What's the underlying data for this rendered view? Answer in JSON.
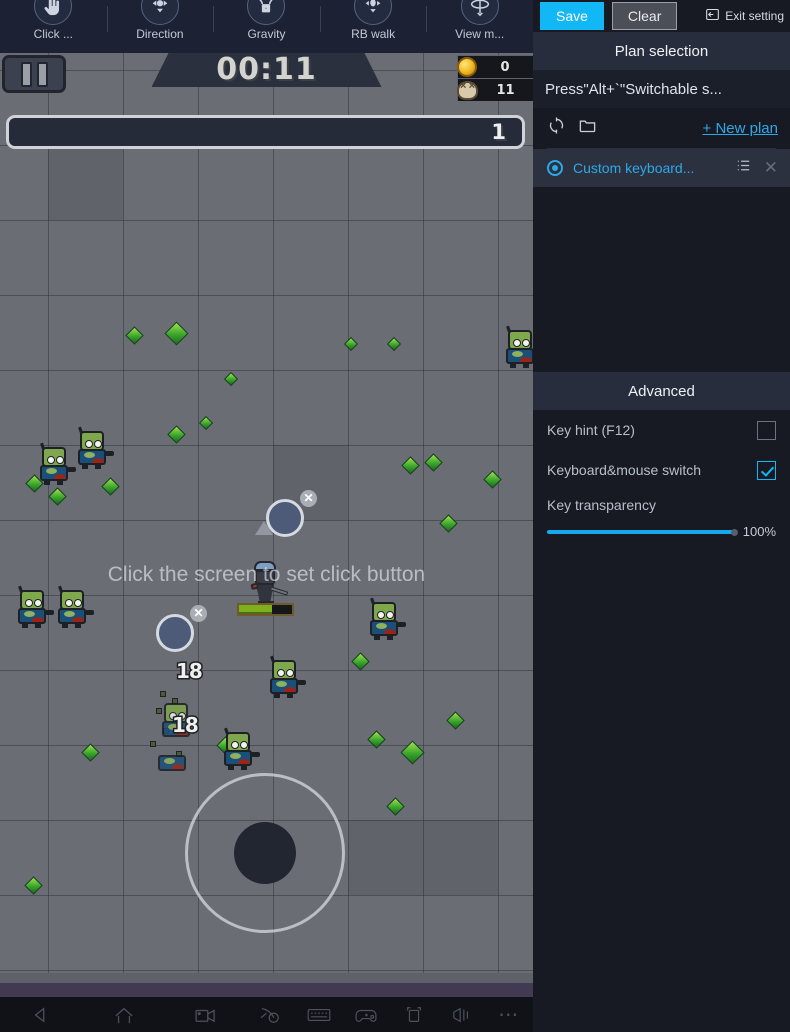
{
  "toolbar": {
    "items": [
      {
        "label": "Click ...",
        "icon": "click-hand-icon"
      },
      {
        "label": "Direction",
        "icon": "direction-pad-icon"
      },
      {
        "label": "Gravity",
        "icon": "gravity-icon"
      },
      {
        "label": "RB walk",
        "icon": "rb-walk-icon"
      },
      {
        "label": "View m...",
        "icon": "view-mode-icon"
      }
    ]
  },
  "game": {
    "timer": "00:11",
    "coin_count": "0",
    "kill_count": "11",
    "level": "1",
    "hint": "Click the screen to set click button",
    "damage_numbers": [
      "18",
      "18"
    ],
    "close_marker": "✕",
    "health_percent": 62
  },
  "side": {
    "save_label": "Save",
    "clear_label": "Clear",
    "exit_label": "Exit setting",
    "plan_section": {
      "title": "Plan selection",
      "hint": "Press\"Alt+`\"Switchable s...",
      "refresh_icon": "refresh-icon",
      "folder_icon": "folder-icon",
      "new_plan_label": "+ New plan",
      "plans": [
        {
          "name": "Custom keyboard...",
          "selected": true,
          "list_icon": "list-icon",
          "close_icon": "close-icon"
        }
      ]
    },
    "advanced_section": {
      "title": "Advanced",
      "rows": [
        {
          "label": "Key hint (F12)",
          "checked": false
        },
        {
          "label": "Keyboard&mouse switch",
          "checked": true
        }
      ],
      "slider": {
        "label": "Key transparency",
        "value": "100%",
        "percent": 100
      }
    }
  },
  "bottom_nav": {
    "items": [
      "back-icon",
      "home-icon",
      "record-icon",
      "screenshot-icon",
      "keyboard-icon",
      "gamepad-icon",
      "resize-icon",
      "volume-icon",
      "more-icon"
    ]
  },
  "colors": {
    "accent": "#12b7f5",
    "panel_header": "#272d3c",
    "panel_bg": "#171a23",
    "toolbar_bg": "#1c2233",
    "game_bg": "#6a6d74"
  }
}
